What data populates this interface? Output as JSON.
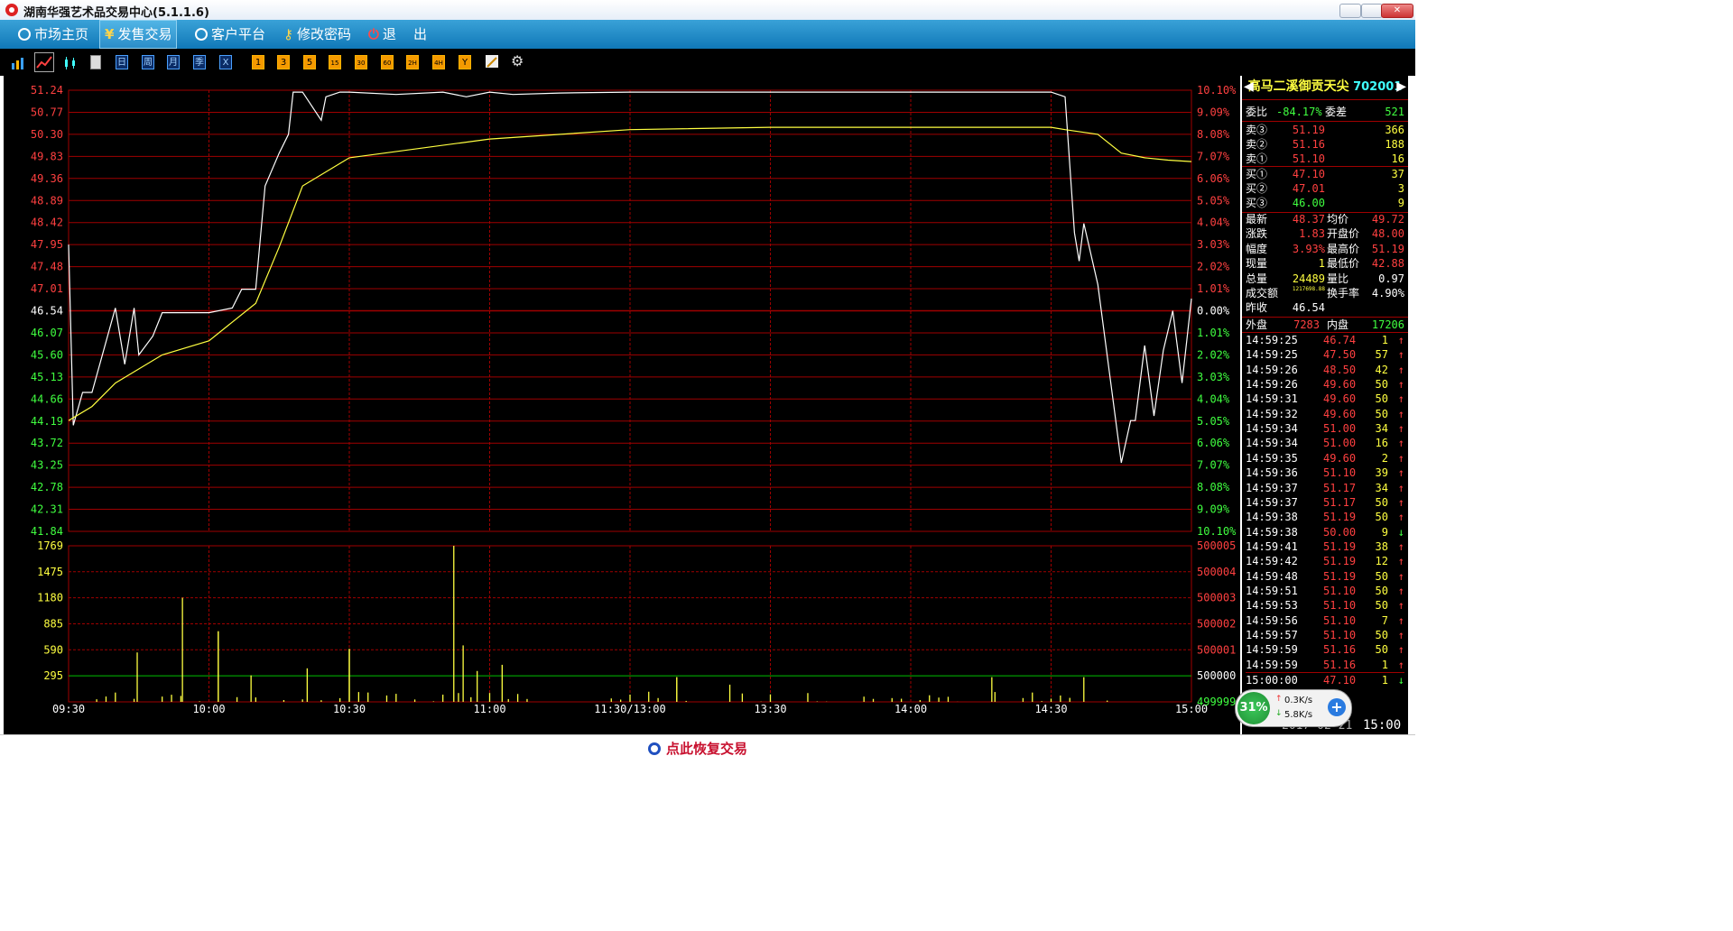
{
  "window": {
    "title": "湖南华强艺术品交易中心(5.1.1.6)"
  },
  "menu": [
    {
      "label": "市场主页",
      "icon": "gear-icon"
    },
    {
      "label": "发售交易",
      "icon": "yen-icon",
      "active": true
    },
    {
      "label": "客户平台",
      "icon": "gear-icon"
    },
    {
      "label": "修改密码",
      "icon": "key-icon"
    },
    {
      "label": "退    出",
      "icon": "power-icon"
    }
  ],
  "toolbar": {
    "periods": [
      "日",
      "周",
      "月",
      "季",
      "X"
    ],
    "minutes": [
      "1",
      "3",
      "5",
      "15",
      "30",
      "60",
      "2H",
      "4H",
      "Y"
    ]
  },
  "chart": {
    "price_ticks_left": [
      "51.24",
      "50.77",
      "50.30",
      "49.83",
      "49.36",
      "48.89",
      "48.42",
      "47.95",
      "47.48",
      "47.01",
      "46.54",
      "46.07",
      "45.60",
      "45.13",
      "44.66",
      "44.19",
      "43.72",
      "43.25",
      "42.78",
      "42.31",
      "41.84"
    ],
    "pct_ticks_right": [
      "10.10%",
      "9.09%",
      "8.08%",
      "7.07%",
      "6.06%",
      "5.05%",
      "4.04%",
      "3.03%",
      "2.02%",
      "1.01%",
      "0.00%",
      "1.01%",
      "2.02%",
      "3.03%",
      "4.04%",
      "5.05%",
      "6.06%",
      "7.07%",
      "8.08%",
      "9.09%",
      "10.10%"
    ],
    "volume_ticks_left": [
      "1769",
      "1475",
      "1180",
      "885",
      "590",
      "295"
    ],
    "volume_ticks_right": [
      "500005",
      "500004",
      "500003",
      "500002",
      "500001",
      "500000",
      "499999"
    ],
    "time_ticks": [
      "09:30",
      "10:00",
      "10:30",
      "11:00",
      "11:30/13:00",
      "13:30",
      "14:00",
      "14:30",
      "15:00"
    ]
  },
  "chart_data": {
    "type": "line",
    "title": "",
    "xlabel": "",
    "ylabel": "",
    "ylim": [
      41.84,
      51.24
    ],
    "prev_close": 46.54,
    "grid": true,
    "series": [
      {
        "name": "",
        "color": "#ffffff",
        "x": [
          "09:30",
          "09:31",
          "09:33",
          "09:35",
          "09:40",
          "09:42",
          "09:44",
          "09:45",
          "09:48",
          "09:50",
          "09:55",
          "10:00",
          "10:05",
          "10:07",
          "10:10",
          "10:12",
          "10:15",
          "10:17",
          "10:18",
          "10:20",
          "10:24",
          "10:25",
          "10:28",
          "10:30",
          "10:40",
          "10:50",
          "10:55",
          "11:00",
          "11:05",
          "11:15",
          "11:30",
          "13:30",
          "14:00",
          "14:30",
          "14:33",
          "14:35",
          "14:36",
          "14:37",
          "14:40",
          "14:45",
          "14:47",
          "14:48",
          "14:50",
          "14:52",
          "14:54",
          "14:56",
          "14:58",
          "15:00"
        ],
        "values": [
          47.95,
          44.1,
          44.8,
          44.8,
          46.6,
          45.4,
          46.6,
          45.6,
          46.0,
          46.5,
          46.5,
          46.5,
          46.6,
          47.0,
          47.0,
          49.2,
          49.9,
          50.3,
          51.2,
          51.2,
          50.6,
          51.1,
          51.2,
          51.2,
          51.15,
          51.2,
          51.1,
          51.2,
          51.15,
          51.18,
          51.2,
          51.2,
          51.2,
          51.2,
          51.1,
          48.2,
          47.6,
          48.4,
          47.1,
          43.3,
          44.2,
          44.2,
          45.8,
          44.3,
          45.7,
          46.54,
          45.0,
          46.8
        ]
      },
      {
        "name": "",
        "color": "#ffff40",
        "x": [
          "09:30",
          "09:35",
          "09:40",
          "09:50",
          "10:00",
          "10:10",
          "10:15",
          "10:20",
          "10:30",
          "11:00",
          "11:30",
          "13:30",
          "14:00",
          "14:30",
          "14:33",
          "14:40",
          "14:45",
          "14:50",
          "14:55",
          "15:00"
        ],
        "values": [
          44.2,
          44.5,
          45.0,
          45.6,
          45.9,
          46.7,
          47.9,
          49.2,
          49.8,
          50.2,
          50.4,
          50.45,
          50.45,
          50.45,
          50.4,
          50.3,
          49.9,
          49.8,
          49.75,
          49.72
        ]
      }
    ],
    "volume": {
      "ylim": [
        0,
        1769
      ],
      "peak": 1769
    }
  },
  "quote": {
    "name": "高马二溪御贡天尖",
    "code": "702001",
    "weibi_label": "委比",
    "weibi": "-84.17%",
    "weicha_label": "委差",
    "weicha": "521",
    "asks": [
      {
        "label": "卖③",
        "price": "51.19",
        "qty": "366"
      },
      {
        "label": "卖②",
        "price": "51.16",
        "qty": "188"
      },
      {
        "label": "卖①",
        "price": "51.10",
        "qty": "16"
      }
    ],
    "bids": [
      {
        "label": "买①",
        "price": "47.10",
        "qty": "37"
      },
      {
        "label": "买②",
        "price": "47.01",
        "qty": "3"
      },
      {
        "label": "买③",
        "price": "46.00",
        "qty": "9"
      }
    ],
    "stats": [
      [
        "最新",
        "48.37",
        "均价",
        "49.72"
      ],
      [
        "涨跌",
        "1.83",
        "开盘价",
        "48.00"
      ],
      [
        "幅度",
        "3.93%",
        "最高价",
        "51.19"
      ],
      [
        "现量",
        "1",
        "最低价",
        "42.88"
      ],
      [
        "总量",
        "24489",
        "量比",
        "0.97"
      ],
      [
        "成交额",
        "1217698.88",
        "换手率",
        "4.90%"
      ],
      [
        "昨收",
        "46.54",
        "",
        ""
      ]
    ],
    "waipan_label": "外盘",
    "waipan": "7283",
    "neipan_label": "内盘",
    "neipan": "17206",
    "ticks": [
      [
        "14:59:25",
        "46.74",
        "1",
        "up"
      ],
      [
        "14:59:25",
        "47.50",
        "57",
        "up"
      ],
      [
        "14:59:26",
        "48.50",
        "42",
        "up"
      ],
      [
        "14:59:26",
        "49.60",
        "50",
        "up"
      ],
      [
        "14:59:31",
        "49.60",
        "50",
        "up"
      ],
      [
        "14:59:32",
        "49.60",
        "50",
        "up"
      ],
      [
        "14:59:34",
        "51.00",
        "34",
        "up"
      ],
      [
        "14:59:34",
        "51.00",
        "16",
        "up"
      ],
      [
        "14:59:35",
        "49.60",
        "2",
        "up"
      ],
      [
        "14:59:36",
        "51.10",
        "39",
        "up"
      ],
      [
        "14:59:37",
        "51.17",
        "34",
        "up"
      ],
      [
        "14:59:37",
        "51.17",
        "50",
        "up"
      ],
      [
        "14:59:38",
        "51.19",
        "50",
        "up"
      ],
      [
        "14:59:38",
        "50.00",
        "9",
        "down"
      ],
      [
        "14:59:41",
        "51.19",
        "38",
        "up"
      ],
      [
        "14:59:42",
        "51.19",
        "12",
        "up"
      ],
      [
        "14:59:48",
        "51.19",
        "50",
        "up"
      ],
      [
        "14:59:51",
        "51.10",
        "50",
        "up"
      ],
      [
        "14:59:53",
        "51.10",
        "50",
        "up"
      ],
      [
        "14:59:56",
        "51.10",
        "7",
        "up"
      ],
      [
        "14:59:57",
        "51.10",
        "50",
        "up"
      ],
      [
        "14:59:59",
        "51.16",
        "50",
        "up"
      ],
      [
        "14:59:59",
        "51.16",
        "1",
        "up"
      ],
      [
        "15:00:00",
        "47.10",
        "1",
        "down"
      ]
    ],
    "status_date": "2017-02-21",
    "status_time": "15:00"
  },
  "network": {
    "percent": "31%",
    "up": "0.3K/s",
    "down": "5.8K/s"
  },
  "bottom": {
    "restore_label": "点此恢复交易"
  },
  "colors": {
    "grid": "#a00000",
    "price_line": "#ffffff",
    "avg_line": "#ffff40",
    "up": "#ff4040",
    "down": "#40ff40",
    "baseline": "#00c000"
  }
}
